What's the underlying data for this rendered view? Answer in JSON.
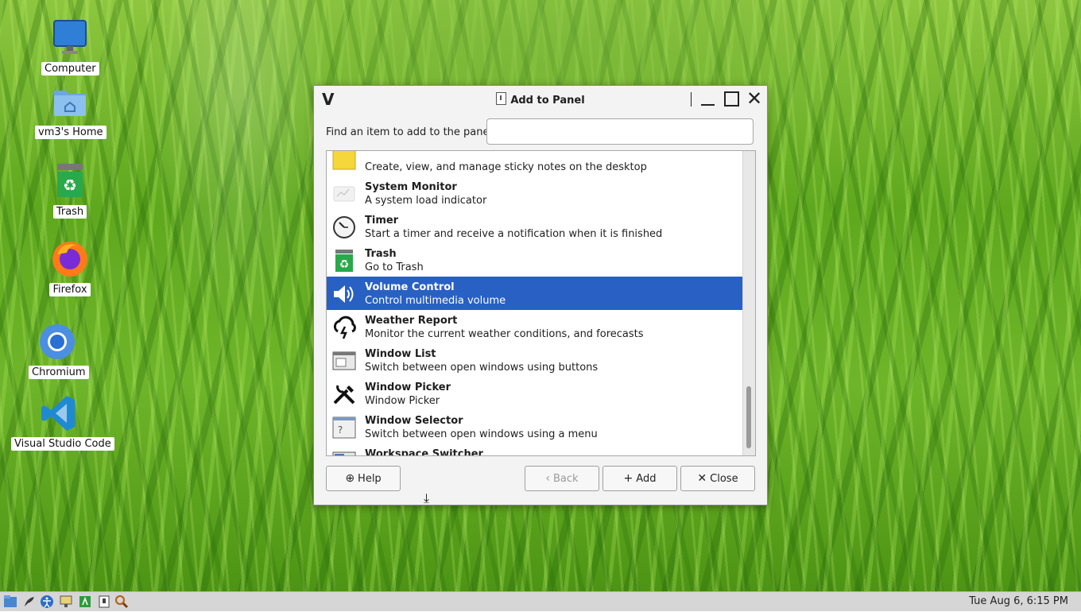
{
  "desktop": {
    "icons": [
      {
        "label": "Computer",
        "icon": "monitor-icon"
      },
      {
        "label": "vm3's Home",
        "icon": "home-folder-icon"
      },
      {
        "label": "Trash",
        "icon": "trash-icon"
      },
      {
        "label": "Firefox",
        "icon": "firefox-icon"
      },
      {
        "label": "Chromium",
        "icon": "chromium-icon"
      },
      {
        "label": "Visual Studio Code",
        "icon": "vscode-icon"
      }
    ]
  },
  "dialog": {
    "title": "Add to Panel",
    "find_label": "Find an item to add to the panel:",
    "search_value": "",
    "items": [
      {
        "name": "",
        "desc": "Create, view, and manage sticky notes on the desktop",
        "icon": "sticky-notes-icon",
        "selected": false
      },
      {
        "name": "System Monitor",
        "desc": "A system load indicator",
        "icon": "system-monitor-icon",
        "selected": false
      },
      {
        "name": "Timer",
        "desc": "Start a timer and receive a notification when it is finished",
        "icon": "timer-icon",
        "selected": false
      },
      {
        "name": "Trash",
        "desc": "Go to Trash",
        "icon": "trash-icon",
        "selected": false
      },
      {
        "name": "Volume Control",
        "desc": "Control multimedia volume",
        "icon": "speaker-icon",
        "selected": true
      },
      {
        "name": "Weather Report",
        "desc": "Monitor the current weather conditions, and forecasts",
        "icon": "weather-icon",
        "selected": false
      },
      {
        "name": "Window List",
        "desc": "Switch between open windows using buttons",
        "icon": "window-list-icon",
        "selected": false
      },
      {
        "name": "Window Picker",
        "desc": "Window Picker",
        "icon": "tools-icon",
        "selected": false
      },
      {
        "name": "Window Selector",
        "desc": "Switch between open windows using a menu",
        "icon": "window-selector-icon",
        "selected": false
      },
      {
        "name": "Workspace Switcher",
        "desc": "",
        "icon": "workspace-switcher-icon",
        "selected": false
      }
    ],
    "buttons": {
      "help": "Help",
      "back": "Back",
      "add": "Add",
      "close": "Close"
    },
    "selection_color": "#2860c4"
  },
  "taskbar": {
    "launchers": [
      "menu-icon",
      "terminal-icon",
      "accessibility-icon",
      "monitor-icon",
      "run-icon",
      "window-icon",
      "search-icon"
    ],
    "clock": "Tue Aug  6,  6:15 PM"
  }
}
